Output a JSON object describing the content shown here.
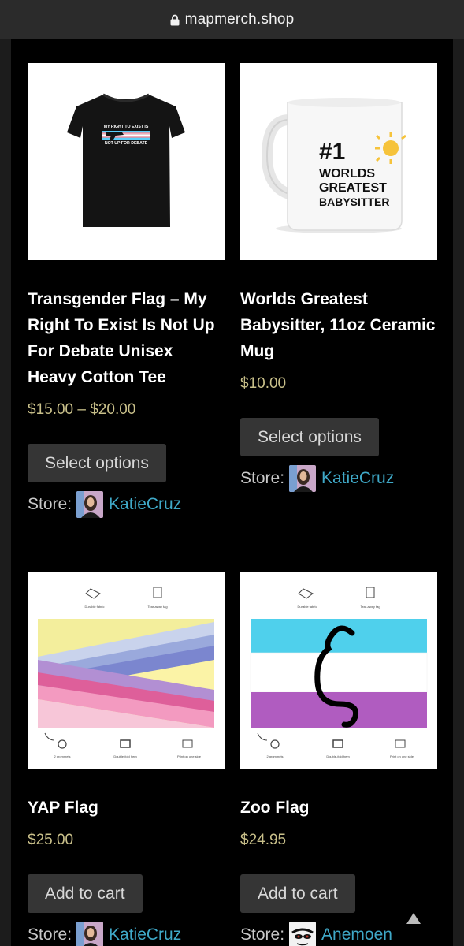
{
  "browser": {
    "domain": "mapmerch.shop",
    "lock_icon": "lock-icon"
  },
  "products": [
    {
      "title": "Transgender Flag – My Right To Exist Is Not Up For Debate Unisex Heavy Cotton Tee",
      "price": "$15.00 – $20.00",
      "button": "Select options",
      "store_label": "Store:",
      "store_name": "KatieCruz",
      "image": {
        "shirt_line1": "MY RIGHT TO EXIST IS",
        "shirt_line2": "NOT UP FOR DEBATE"
      }
    },
    {
      "title": "Worlds Greatest Babysitter, 11oz Ceramic Mug",
      "price": "$10.00",
      "button": "Select options",
      "store_label": "Store:",
      "store_name": "KatieCruz",
      "image": {
        "mug_line1": "#1",
        "mug_line2": "WORLDS",
        "mug_line3": "GREATEST",
        "mug_line4": "BABYSITTER"
      }
    },
    {
      "title": "YAP Flag",
      "price": "$25.00",
      "button": "Add to cart",
      "store_label": "Store:",
      "store_name": "KatieCruz",
      "image": {
        "feature1": "Durable fabric",
        "feature2": "Tear-away tag",
        "feature3": "2 grommets",
        "feature4": "Double-fold hem",
        "feature5": "Print on one side"
      }
    },
    {
      "title": "Zoo Flag",
      "price": "$24.95",
      "button": "Add to cart",
      "store_label": "Store:",
      "store_name": "Anemoen",
      "image": {
        "feature1": "Durable fabric",
        "feature2": "Tear-away tag",
        "feature3": "2 grommets",
        "feature4": "Double-fold hem",
        "feature5": "Print on one side"
      }
    }
  ],
  "colors": {
    "price": "#c9c08a",
    "store_link": "#3fa9c8",
    "button_bg": "#353535"
  }
}
